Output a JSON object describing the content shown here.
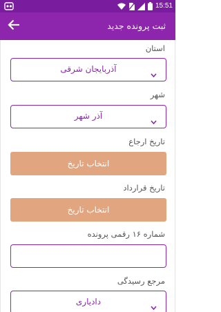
{
  "status_bar": {
    "time": "15:51",
    "icons": [
      "app-notification-icon",
      "wifi-icon",
      "no-sim-icon",
      "signal-icon",
      "battery-icon"
    ]
  },
  "app_bar": {
    "title": "ثبت پرونده جدید",
    "back_icon": "arrow-back-icon",
    "color": "#8e25ad"
  },
  "form": {
    "province": {
      "label": "استان",
      "value": "آذربایجان شرقی"
    },
    "city": {
      "label": "شهر",
      "value": "آذر شهر"
    },
    "referral_date": {
      "label": "تاریخ ارجاع",
      "button": "انتخاب تاریخ"
    },
    "contract_date": {
      "label": "تاریخ قرارداد",
      "button": "انتخاب تاریخ"
    },
    "file_number": {
      "label": "شماره ۱۶ رقمی پرونده",
      "value": "",
      "placeholder": ""
    },
    "authority": {
      "label": "مرجع رسیدگی",
      "value": "دادیاری"
    }
  },
  "colors": {
    "primary": "#8e25ad",
    "status_bar": "#7a1c9e",
    "date_button": "#e1a57f"
  }
}
